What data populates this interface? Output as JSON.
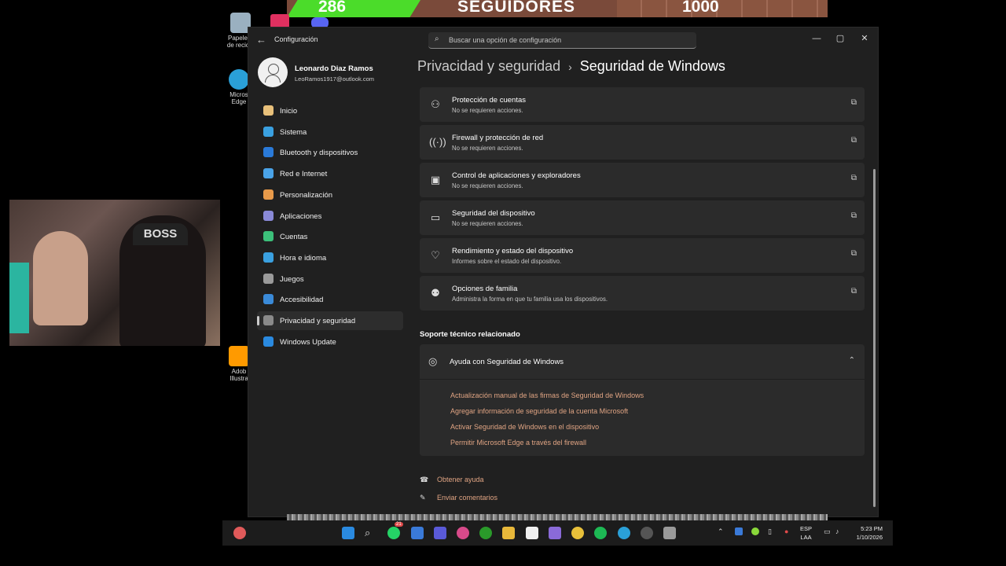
{
  "overlay": {
    "follower_count": "286",
    "follower_label": "SEGUIDORES",
    "follower_goal": "1000",
    "webcam_cap_text": "BOSS"
  },
  "desktop_icons": [
    {
      "label": "Papelera de recicla"
    },
    {
      "label": "Micros Edge"
    },
    {
      "label": "Adob Illustra"
    }
  ],
  "window": {
    "app_title": "Configuración",
    "search_placeholder": "Buscar una opción de configuración",
    "controls": {
      "minimize": "—",
      "maximize": "▢",
      "close": "✕"
    }
  },
  "user": {
    "name": "Leonardo Diaz Ramos",
    "email": "LeoRamos1917@outlook.com"
  },
  "sidebar": {
    "items": [
      {
        "label": "Inicio",
        "color": "#e8c07a"
      },
      {
        "label": "Sistema",
        "color": "#3aa0e0"
      },
      {
        "label": "Bluetooth y dispositivos",
        "color": "#2a7ad8"
      },
      {
        "label": "Red e Internet",
        "color": "#4aa3e8"
      },
      {
        "label": "Personalización",
        "color": "#e89a4a"
      },
      {
        "label": "Aplicaciones",
        "color": "#8a8ad8"
      },
      {
        "label": "Cuentas",
        "color": "#3cc07a"
      },
      {
        "label": "Hora e idioma",
        "color": "#3aa0e0"
      },
      {
        "label": "Juegos",
        "color": "#9a9a9a"
      },
      {
        "label": "Accesibilidad",
        "color": "#3a8ad8"
      },
      {
        "label": "Privacidad y seguridad",
        "color": "#8a8a8a"
      },
      {
        "label": "Windows Update",
        "color": "#2a8ae0"
      }
    ],
    "selected_index": 10
  },
  "page": {
    "breadcrumb_parent": "Privacidad y seguridad",
    "breadcrumb_separator": "›",
    "breadcrumb_current": "Seguridad de Windows"
  },
  "cards": [
    {
      "title": "Protección de cuentas",
      "subtitle": "No se requieren acciones.",
      "icon": "account-shield-icon"
    },
    {
      "title": "Firewall y protección de red",
      "subtitle": "No se requieren acciones.",
      "icon": "wifi-shield-icon"
    },
    {
      "title": "Control de aplicaciones y exploradores",
      "subtitle": "No se requieren acciones.",
      "icon": "app-browser-icon"
    },
    {
      "title": "Seguridad del dispositivo",
      "subtitle": "No se requieren acciones.",
      "icon": "device-icon"
    },
    {
      "title": "Rendimiento y estado del dispositivo",
      "subtitle": "Informes sobre el estado del dispositivo.",
      "icon": "heart-icon"
    },
    {
      "title": "Opciones de familia",
      "subtitle": "Administra la forma en que tu familia usa los dispositivos.",
      "icon": "family-icon"
    }
  ],
  "related": {
    "section_title": "Soporte técnico relacionado",
    "help_title": "Ayuda con Seguridad de Windows",
    "links": [
      "Actualización manual de las firmas de Seguridad de Windows",
      "Agregar información de seguridad de la cuenta Microsoft",
      "Activar Seguridad de Windows en el dispositivo",
      "Permitir Microsoft Edge a través del firewall"
    ]
  },
  "footer": {
    "get_help": "Obtener ayuda",
    "send_feedback": "Enviar comentarios"
  },
  "taskbar": {
    "whatsapp_badge": "21",
    "lang_line1": "ESP",
    "lang_line2": "LAA",
    "time": "5:23 PM",
    "date": "1/10/2026"
  },
  "colors": {
    "link": "#e0a483",
    "card_bg": "#2b2b2b",
    "window_bg": "#202020"
  }
}
